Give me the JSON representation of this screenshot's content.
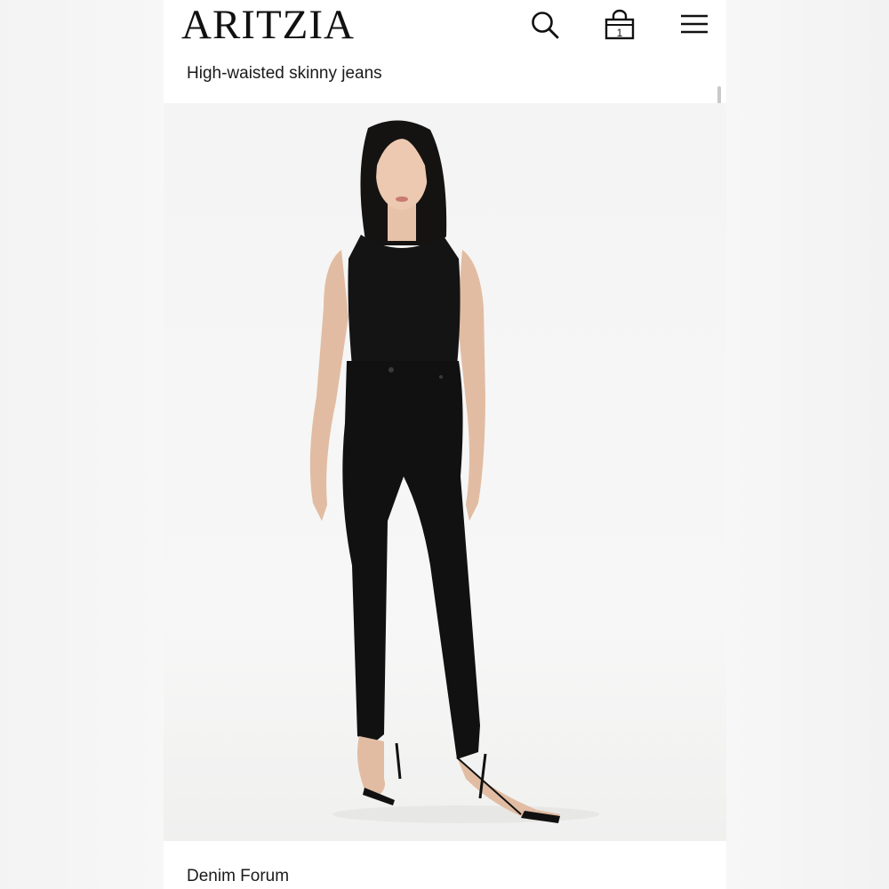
{
  "header": {
    "brand": "ARITZIA",
    "icons": [
      "search-icon",
      "shopping-bag-icon",
      "menu-icon"
    ],
    "bag_count": "1"
  },
  "product": {
    "title": "High-waisted skinny jeans",
    "image_alt": "Model wearing black tank top and high-waisted black skinny jeans with strappy heels"
  },
  "footer": {
    "brand_label": "Denim Forum"
  },
  "colors": {
    "background": "#ffffff",
    "text": "#1a1a1a",
    "garment": "#111111"
  }
}
